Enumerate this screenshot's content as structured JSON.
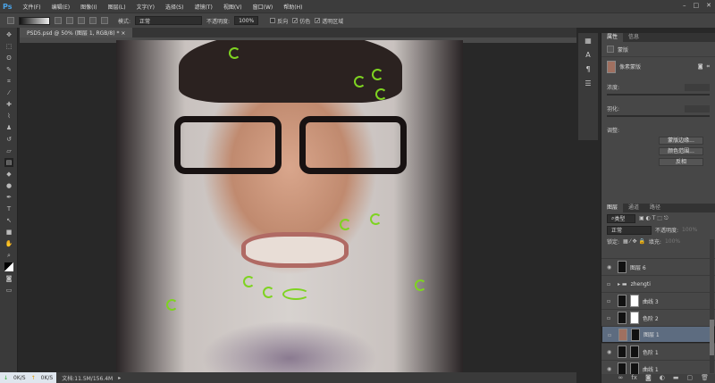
{
  "app": {
    "logo": "Ps"
  },
  "menu": [
    "文件(F)",
    "编辑(E)",
    "图像(I)",
    "图层(L)",
    "文字(Y)",
    "选择(S)",
    "滤镜(T)",
    "视图(V)",
    "窗口(W)",
    "帮助(H)"
  ],
  "options": {
    "mode_label": "模式:",
    "mode_value": "正常",
    "opacity_label": "不透明度:",
    "opacity_value": "100%",
    "reverse": "反向",
    "dither": "仿色",
    "transparency": "透明区域",
    "reverse_checked": false,
    "dither_checked": true,
    "transparency_checked": true
  },
  "document": {
    "tab": "PSD5.psd @ 50% (图层 1, RGB/8) *",
    "close": "×"
  },
  "status": {
    "zoom": "50%",
    "doc": "文档:11.5M/156.4M",
    "net_down": "0K/S",
    "net_up": "0K/S"
  },
  "properties": {
    "tabs": [
      "属性",
      "信息"
    ],
    "section": "蒙版",
    "mask_name": "像素蒙版",
    "density_label": "浓度:",
    "feather_label": "羽化:",
    "adjust_label": "调整:",
    "buttons": [
      "蒙版边缘...",
      "颜色范围...",
      "反相"
    ]
  },
  "layers_panel": {
    "tabs": [
      "图层",
      "通道",
      "路径"
    ],
    "filter": "类型",
    "blend": "正常",
    "opacity_label": "不透明度:",
    "opacity_value": "100%",
    "lock_label": "锁定:",
    "fill_label": "填充:",
    "fill_value": "100%",
    "layers": [
      {
        "name": "图层 6",
        "visible": true,
        "selected": false
      },
      {
        "name": "zhengti",
        "visible": false,
        "selected": false,
        "group": true
      },
      {
        "name": "曲线 3",
        "visible": false,
        "selected": false
      },
      {
        "name": "色阶 2",
        "visible": false,
        "selected": false
      },
      {
        "name": "图层 1",
        "visible": false,
        "selected": true
      },
      {
        "name": "色阶 1",
        "visible": true,
        "selected": false
      },
      {
        "name": "曲线 1",
        "visible": true,
        "selected": false
      }
    ]
  },
  "colors": {
    "accent": "#4aa3e8",
    "selected_layer": "#5d6c80",
    "doodle": "#7ed321"
  }
}
